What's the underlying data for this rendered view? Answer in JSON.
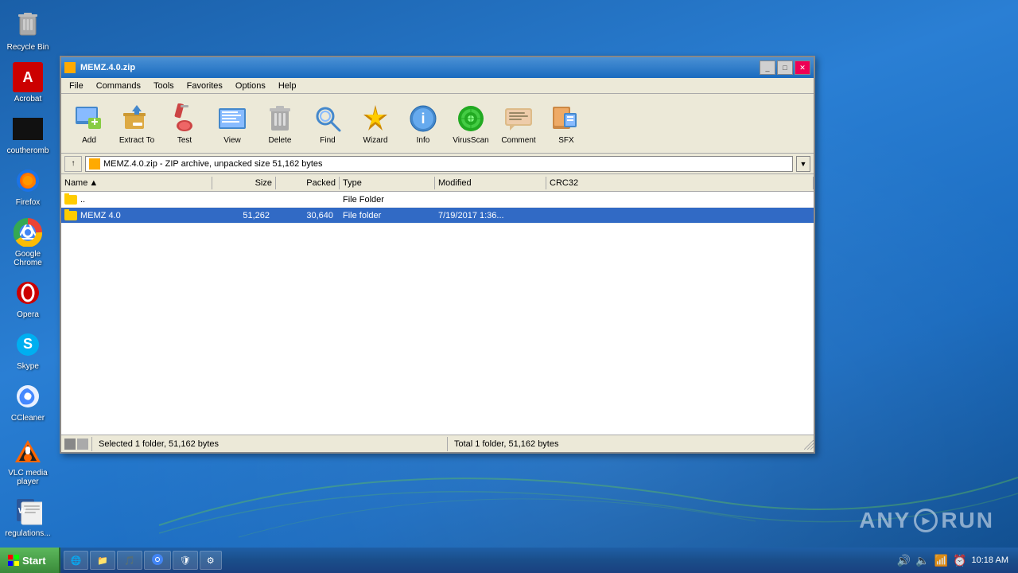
{
  "desktop": {
    "icons": [
      {
        "id": "recycle-bin",
        "label": "Recycle Bin",
        "symbol": "🗑️"
      },
      {
        "id": "acrobat",
        "label": "Acrobat",
        "symbol": "A"
      },
      {
        "id": "coutheromb",
        "label": "coutheromb",
        "symbol": "■"
      },
      {
        "id": "firefox",
        "label": "Firefox",
        "symbol": "🦊"
      },
      {
        "id": "google-chrome",
        "label": "Google Chrome",
        "symbol": "🌐"
      },
      {
        "id": "opera",
        "label": "Opera",
        "symbol": "O"
      },
      {
        "id": "skype",
        "label": "Skype",
        "symbol": "S"
      },
      {
        "id": "ccleaner",
        "label": "CCleaner",
        "symbol": "C"
      }
    ],
    "bottom_icons": [
      {
        "id": "vlc",
        "label": "VLC media player",
        "symbol": "▶"
      },
      {
        "id": "word",
        "label": "regulations...",
        "symbol": "W"
      }
    ]
  },
  "window": {
    "title": "MEMZ.4.0.zip",
    "title_icon": "📦",
    "menu": [
      "File",
      "Commands",
      "Tools",
      "Favorites",
      "Options",
      "Help"
    ],
    "toolbar": [
      {
        "id": "add",
        "label": "Add",
        "icon": "➕"
      },
      {
        "id": "extract-to",
        "label": "Extract To",
        "icon": "📤"
      },
      {
        "id": "test",
        "label": "Test",
        "icon": "🔬"
      },
      {
        "id": "view",
        "label": "View",
        "icon": "📋"
      },
      {
        "id": "delete",
        "label": "Delete",
        "icon": "🗑"
      },
      {
        "id": "find",
        "label": "Find",
        "icon": "🔍"
      },
      {
        "id": "wizard",
        "label": "Wizard",
        "icon": "⚡"
      },
      {
        "id": "info",
        "label": "Info",
        "icon": "ℹ"
      },
      {
        "id": "virusscan",
        "label": "VirusScan",
        "icon": "🛡"
      },
      {
        "id": "comment",
        "label": "Comment",
        "icon": "💬"
      },
      {
        "id": "sfx",
        "label": "SFX",
        "icon": "🧩"
      }
    ],
    "address": "MEMZ.4.0.zip - ZIP archive, unpacked size 51,162 bytes",
    "columns": [
      "Name",
      "Size",
      "Packed",
      "Type",
      "Modified",
      "CRC32"
    ],
    "files": [
      {
        "name": "..",
        "size": "",
        "packed": "",
        "type": "File Folder",
        "modified": "",
        "crc32": "",
        "selected": false
      },
      {
        "name": "MEMZ 4.0",
        "size": "51,262",
        "packed": "30,640",
        "type": "File folder",
        "modified": "7/19/2017 1:36...",
        "crc32": "",
        "selected": true
      }
    ],
    "status_left": "Selected 1 folder, 51,162 bytes",
    "status_right": "Total 1 folder, 51,162 bytes"
  },
  "taskbar": {
    "start_label": "Start",
    "items": [
      {
        "id": "ie",
        "label": "IE",
        "symbol": "e"
      },
      {
        "id": "explorer",
        "label": "Explorer",
        "symbol": "📁"
      },
      {
        "id": "media",
        "label": "Media",
        "symbol": "🎵"
      },
      {
        "id": "chrome-tb",
        "label": "Chrome",
        "symbol": "🌐"
      },
      {
        "id": "defender",
        "label": "Defender",
        "symbol": "🛡"
      },
      {
        "id": "taskmgr",
        "label": "Task Mgr",
        "symbol": "⚙"
      }
    ],
    "clock": "10:18 AM"
  },
  "watermark": "ANY RUN"
}
